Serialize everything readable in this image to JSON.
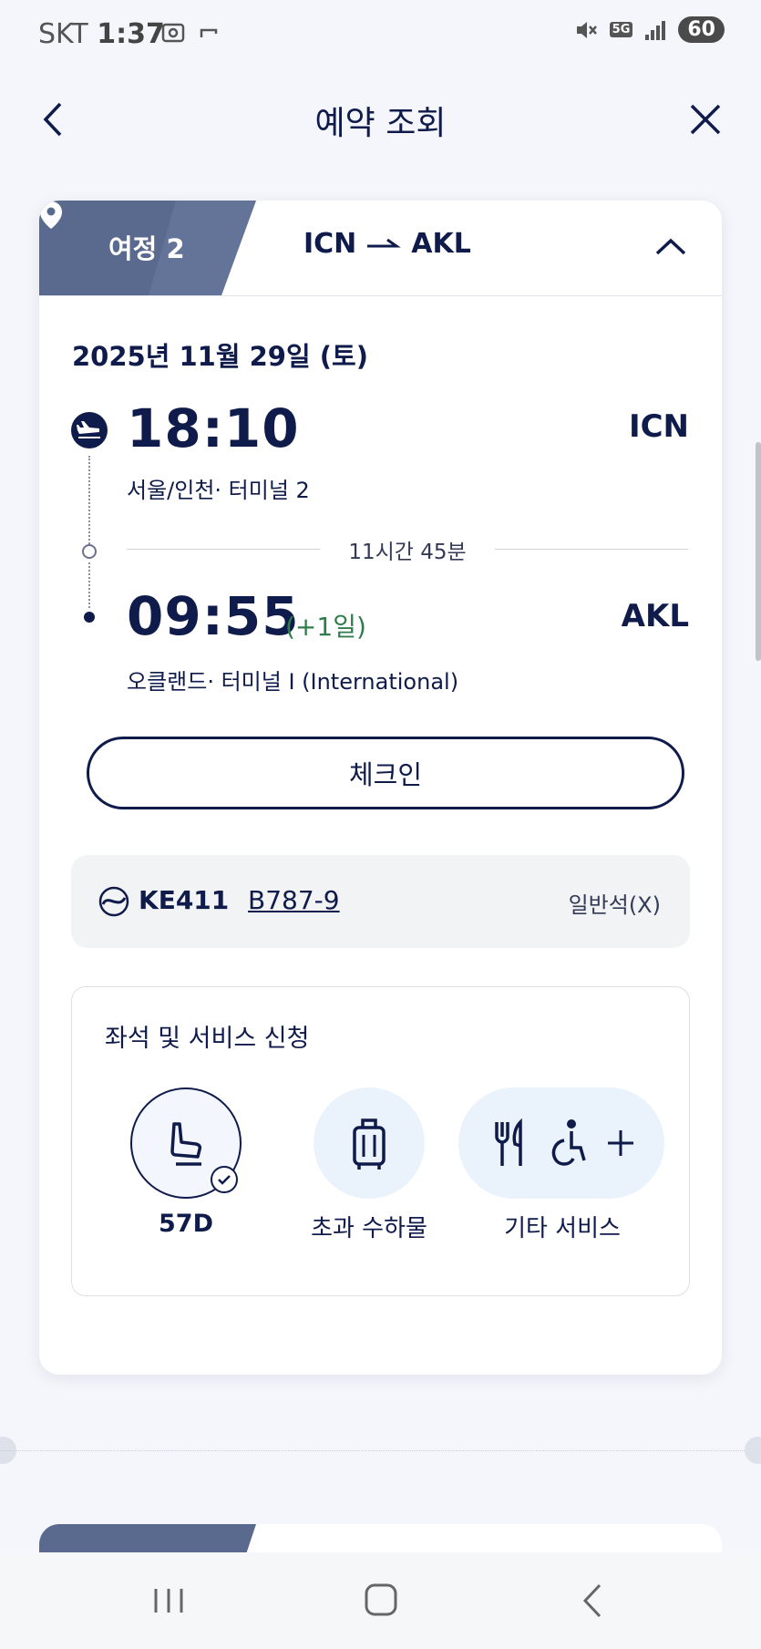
{
  "status_bar": {
    "carrier": "SKT",
    "time": "1:37",
    "network": "5G",
    "battery": "60"
  },
  "header": {
    "title": "예약 조회"
  },
  "segment": {
    "label": "여정 2",
    "origin": "ICN",
    "destination": "AKL",
    "date": "2025년 11월 29일 (토)",
    "departure": {
      "time": "18:10",
      "code": "ICN",
      "place": "서울/인천· 터미널  2"
    },
    "duration": "11시간 45분",
    "arrival": {
      "time": "09:55",
      "day_offset": "(+1일)",
      "code": "AKL",
      "place": "오클랜드· 터미널  I (International)"
    },
    "checkin_label": "체크인",
    "flight": {
      "number": "KE411",
      "aircraft": "B787-9",
      "cabin": "일반석(X)"
    },
    "services": {
      "title": "좌석 및 서비스 신청",
      "seat_label": "57D",
      "baggage_label": "초과 수하물",
      "other_label": "기타 서비스"
    }
  },
  "colors": {
    "navy": "#0f1b4a",
    "tag_blue": "#5a6a8e",
    "green": "#2e7d4a",
    "light_blue": "#eaf2fb"
  }
}
